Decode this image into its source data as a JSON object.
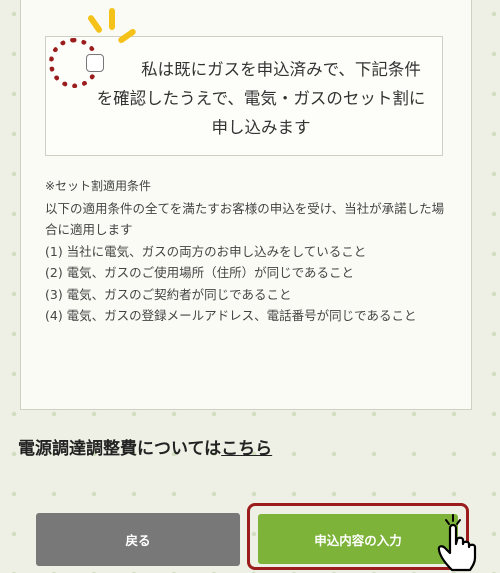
{
  "consent": {
    "text": "私は既にガスを申込済みで、下記条件を確認したうえで、電気・ガスのセット割に申し込みます",
    "checked": false
  },
  "conditions": {
    "heading": "※セット割適用条件",
    "intro": "以下の適用条件の全てを満たすお客様の申込を受け、当社が承諾した場合に適用します",
    "items": [
      "(1) 当社に電気、ガスの両方のお申し込みをしていること",
      "(2) 電気、ガスのご使用場所（住所）が同じであること",
      "(3) 電気、ガスのご契約者が同じであること",
      "(4) 電気、ガスの登録メールアドレス、電話番号が同じであること"
    ]
  },
  "fee_link": {
    "prefix": "電源調達調整費については",
    "link_text": "こちら"
  },
  "buttons": {
    "back_label": "戻る",
    "next_label": "申込内容の入力"
  },
  "colors": {
    "primary_green": "#7cb338",
    "back_gray": "#787878",
    "highlight_red": "#9b1c1c",
    "spark_yellow": "#f5c21a"
  },
  "icons": {
    "pointer": "hand-pointer-icon",
    "spark": "sparkle-icon"
  }
}
